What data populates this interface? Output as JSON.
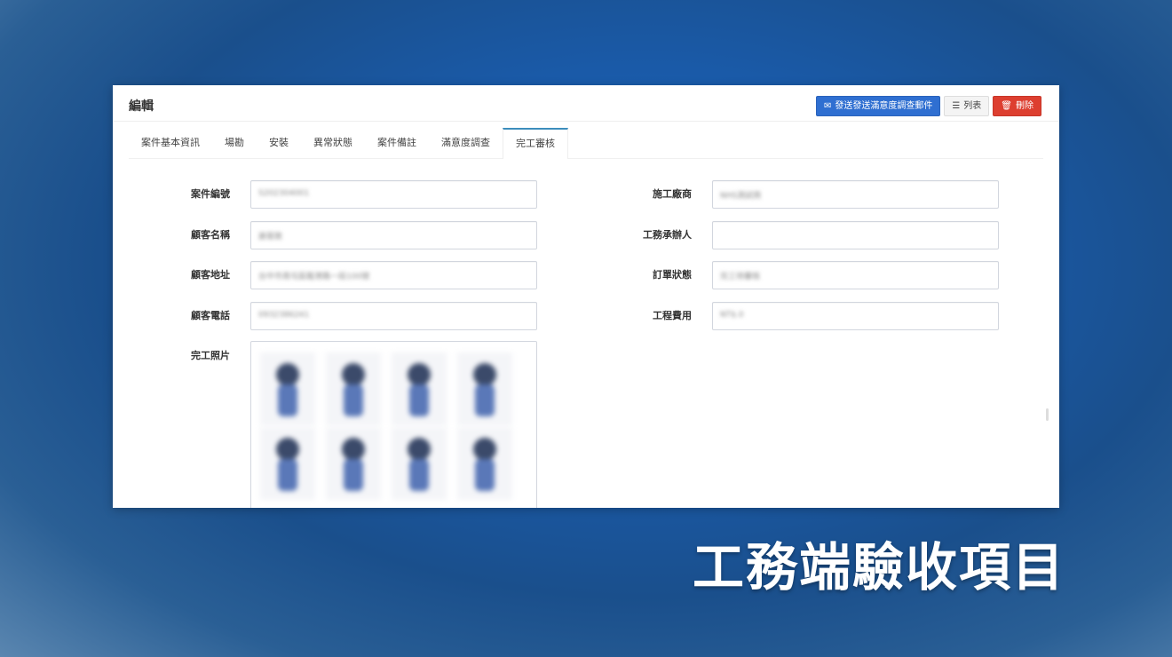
{
  "panel": {
    "title": "編輯",
    "buttons": {
      "send_survey": "發送發送滿意度調查郵件",
      "list": "列表",
      "delete": "刪除"
    }
  },
  "tabs": [
    {
      "label": "案件基本資訊",
      "active": false
    },
    {
      "label": "場勘",
      "active": false
    },
    {
      "label": "安裝",
      "active": false
    },
    {
      "label": "異常狀態",
      "active": false
    },
    {
      "label": "案件備註",
      "active": false
    },
    {
      "label": "滿意度調查",
      "active": false
    },
    {
      "label": "完工審核",
      "active": true
    }
  ],
  "form": {
    "left": [
      {
        "label": "案件編號",
        "value": "S202304001"
      },
      {
        "label": "顧客名稱",
        "value": "謝易致"
      },
      {
        "label": "顧客地址",
        "value": "台中市南屯區龍港路一段100號"
      },
      {
        "label": "顧客電話",
        "value": "0932386241"
      }
    ],
    "right": [
      {
        "label": "施工廠商",
        "value": "NHS測試商"
      },
      {
        "label": "工務承辦人",
        "value": ""
      },
      {
        "label": "訂單狀態",
        "value": "完工待審核"
      },
      {
        "label": "工程費用",
        "value": "NT$.0"
      }
    ],
    "photos_label": "完工照片"
  },
  "caption": "工務端驗收項目",
  "colors": {
    "primary": "#2f6fd1",
    "danger": "#dd3f30",
    "tab_active_border": "#3c8dbc"
  }
}
